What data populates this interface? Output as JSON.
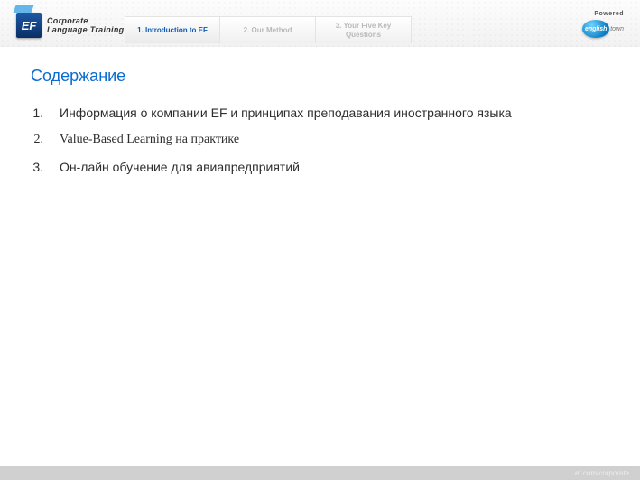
{
  "header": {
    "logo": {
      "mark": "EF",
      "line1": "Corporate",
      "line2": "Language Training"
    },
    "tabs": [
      {
        "label": "1. Introduction to EF",
        "active": true
      },
      {
        "label": "2. Our Method",
        "active": false
      },
      {
        "label": "3. Your Five Key Questions",
        "active": false
      }
    ],
    "powered": {
      "label": "Powered",
      "badge": "english",
      "suffix": "town"
    }
  },
  "content": {
    "title": "Содержание",
    "items": [
      {
        "num": "1.",
        "text": "Информация о компании EF  и принципах преподавания иностранного языка",
        "serif": false
      },
      {
        "num": "2.",
        "text": "Value-Based Learning на практике",
        "serif": true
      },
      {
        "num": "3.",
        "text": "Он-лайн обучение для авиапредприятий",
        "serif": false
      }
    ]
  },
  "footer": {
    "text": "ef.com/corporate"
  }
}
